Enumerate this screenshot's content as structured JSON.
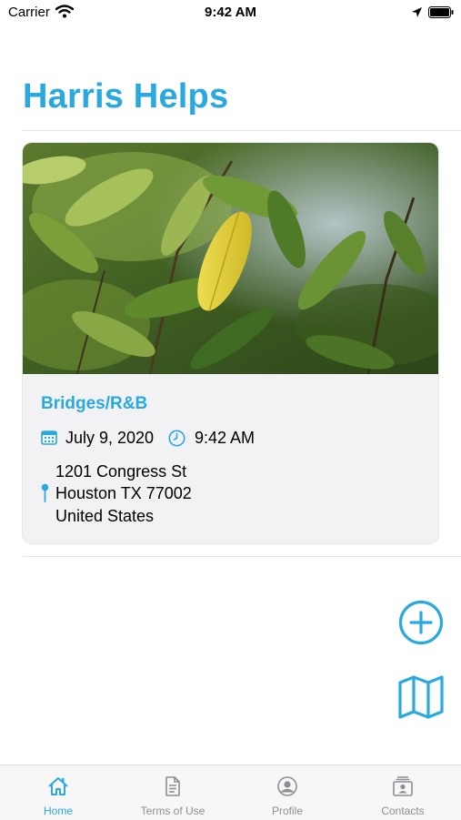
{
  "status_bar": {
    "carrier": "Carrier",
    "time": "9:42 AM"
  },
  "header": {
    "title": "Harris Helps"
  },
  "event_card": {
    "title": "Bridges/R&B",
    "date": "July 9, 2020",
    "time": "9:42 AM",
    "address": [
      "1201 Congress St",
      "Houston TX 77002",
      "United States"
    ]
  },
  "actions": {
    "add_icon": "plus-circle-icon",
    "map_icon": "map-icon"
  },
  "tab_bar": {
    "tabs": [
      {
        "label": "Home",
        "icon": "home-icon",
        "active": true
      },
      {
        "label": "Terms of Use",
        "icon": "document-icon",
        "active": false
      },
      {
        "label": "Profile",
        "icon": "profile-icon",
        "active": false
      },
      {
        "label": "Contacts",
        "icon": "contacts-icon",
        "active": false
      }
    ]
  },
  "colors": {
    "accent": "#2aa9e0",
    "inactive": "#8e8e93",
    "card_bg": "#f2f2f4"
  }
}
